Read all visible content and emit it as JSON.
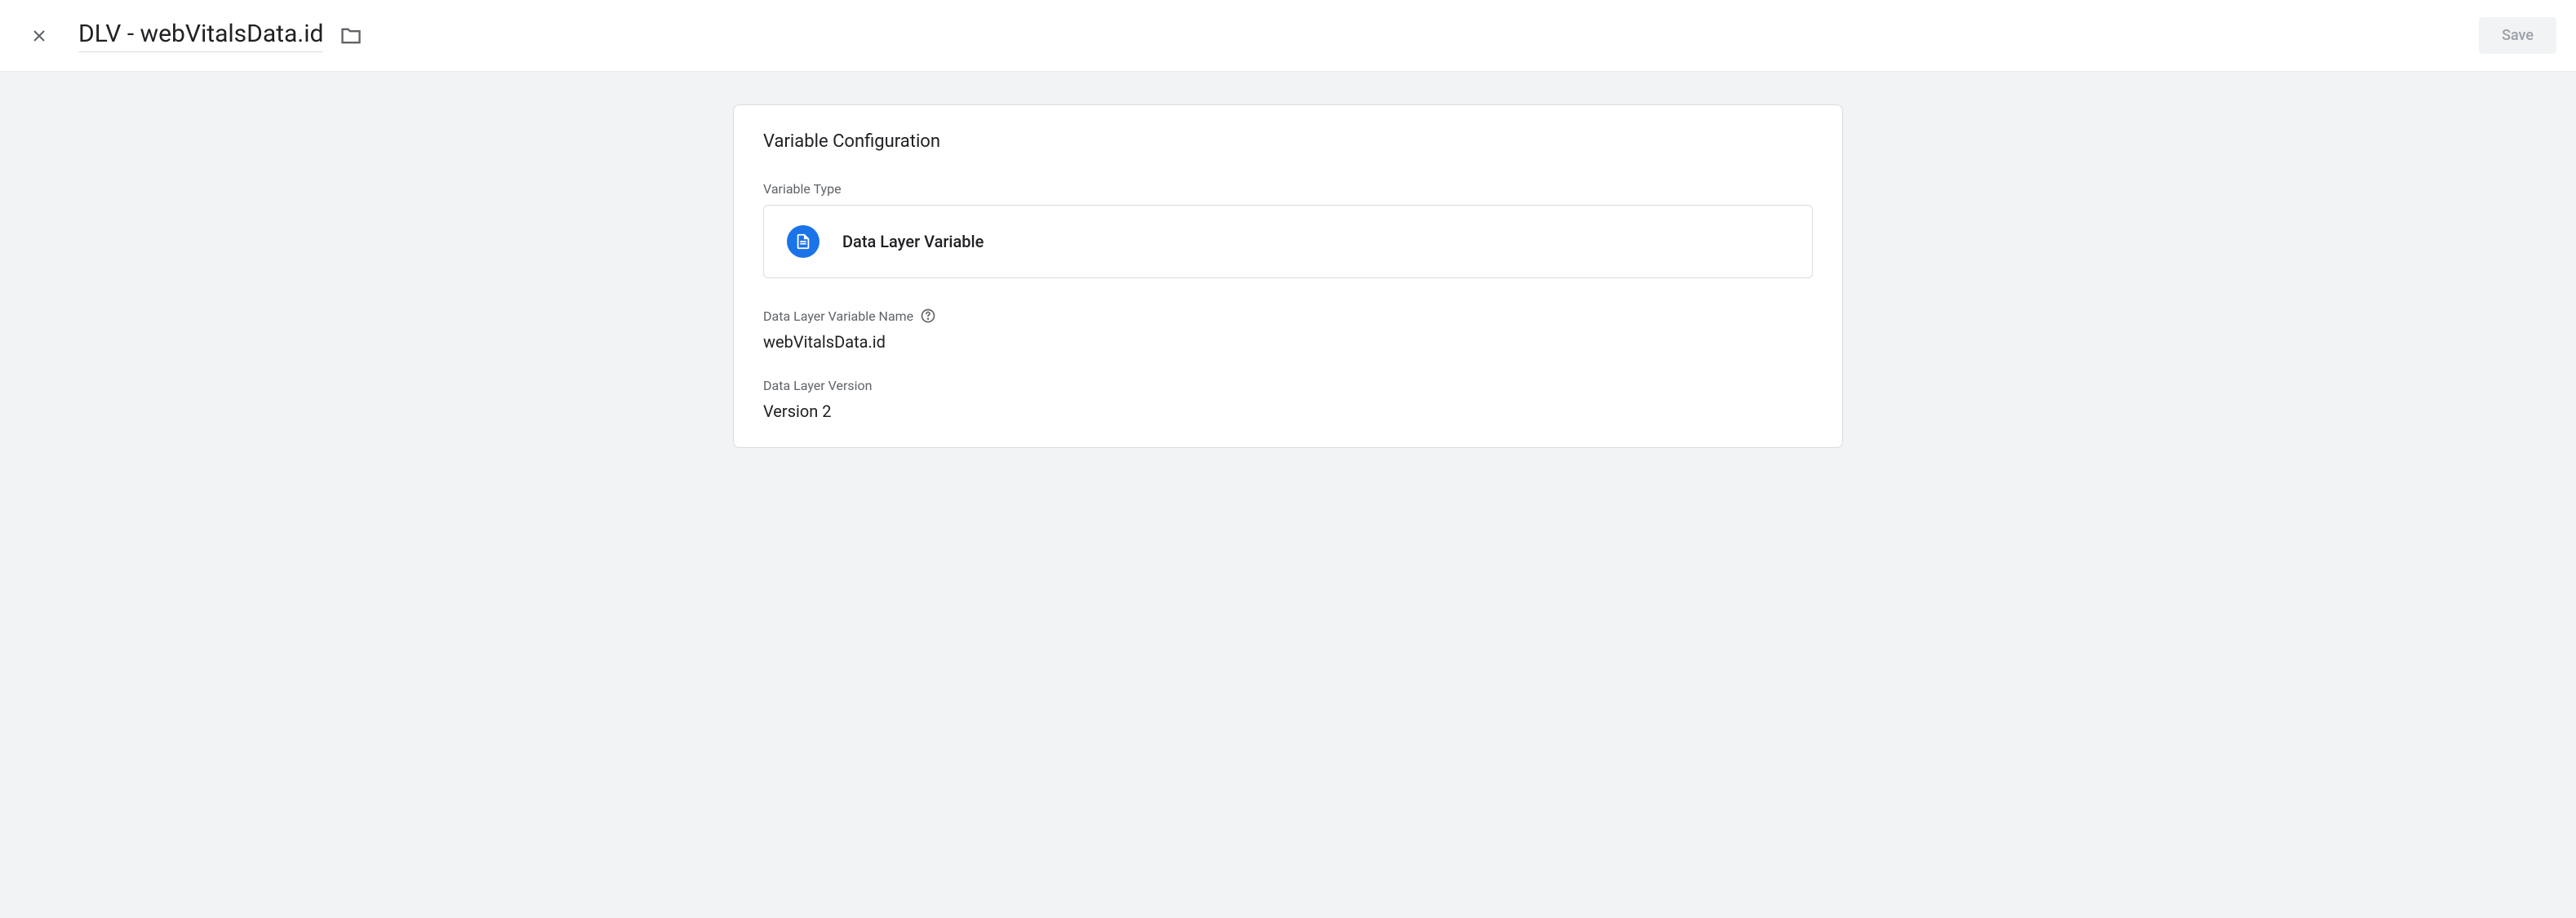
{
  "header": {
    "title": "DLV - webVitalsData.id",
    "save_label": "Save"
  },
  "card": {
    "title": "Variable Configuration",
    "variable_type_label": "Variable Type",
    "variable_type_value": "Data Layer Variable",
    "variable_name_label": "Data Layer Variable Name",
    "variable_name_value": "webVitalsData.id",
    "version_label": "Data Layer Version",
    "version_value": "Version 2"
  }
}
